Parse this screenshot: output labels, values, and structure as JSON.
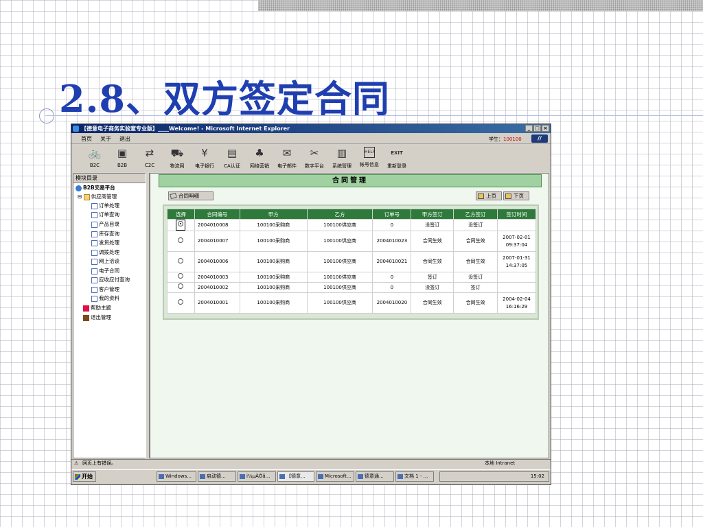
{
  "slide_title": "2.8、双方签定合同",
  "window": {
    "title": "【德意电子商务实验室专业版】____Welcome! - Microsoft Internet Explorer",
    "buttons": [
      "_",
      "□",
      "×"
    ]
  },
  "menu": {
    "items": [
      "首页",
      "关于",
      "退出"
    ],
    "student_label": "学生：",
    "student_id": "100100"
  },
  "toolbar": {
    "items": [
      {
        "label": "B2C",
        "icon": "bike-icon"
      },
      {
        "label": "B2B",
        "icon": "network-icon"
      },
      {
        "label": "C2C",
        "icon": "exchange-icon"
      },
      {
        "label": "物流网",
        "icon": "truck-icon"
      },
      {
        "label": "电子银行",
        "icon": "bank-icon"
      },
      {
        "label": "CA认证",
        "icon": "certificate-icon"
      },
      {
        "label": "网络营销",
        "icon": "org-chart-icon"
      },
      {
        "label": "电子邮件",
        "icon": "mail-icon"
      },
      {
        "label": "数字平台",
        "icon": "tools-icon"
      },
      {
        "label": "系统管理",
        "icon": "computer-icon"
      },
      {
        "label": "帐号信息",
        "icon": "help-icon"
      },
      {
        "label": "重新登录",
        "icon": "exit-icon"
      }
    ],
    "exit_caption": "EXIT",
    "help_caption": "HELP"
  },
  "sidebar": {
    "header": "模块目录",
    "root": "B2B交易平台",
    "group": "供应商管理",
    "items": [
      "订单处理",
      "订单查询",
      "产品目录",
      "库存查询",
      "发货处理",
      "调拨处理",
      "网上洽谈",
      "电子合同",
      "应收应付查询",
      "客户管理",
      "我的资料"
    ],
    "help": "帮助主题",
    "exit": "退出管理"
  },
  "main": {
    "title": "合同管理",
    "detail_button": "合同明细",
    "prev_button": "上页",
    "next_button": "下页",
    "columns": [
      "选择",
      "合同编号",
      "甲方",
      "乙方",
      "订单号",
      "甲方签订",
      "乙方签订",
      "签订时间"
    ],
    "rows": [
      {
        "checked": true,
        "id": "2004010008",
        "party_a": "100100采购商",
        "party_b": "100100供应商",
        "order": "0",
        "a_sign": "没签订",
        "b_sign": "没签订",
        "date": "",
        "time": ""
      },
      {
        "checked": false,
        "id": "2004010007",
        "party_a": "100100采购商",
        "party_b": "100100供应商",
        "order": "2004010023",
        "a_sign": "合同生效",
        "b_sign": "合同生效",
        "date": "2007-02-01",
        "time": "09:37:04"
      },
      {
        "checked": false,
        "id": "2004010006",
        "party_a": "100100采购商",
        "party_b": "100100供应商",
        "order": "2004010021",
        "a_sign": "合同生效",
        "b_sign": "合同生效",
        "date": "2007-01-31",
        "time": "14:37:05"
      },
      {
        "checked": false,
        "id": "2004010003",
        "party_a": "100100采购商",
        "party_b": "100100供应商",
        "order": "0",
        "a_sign": "签订",
        "b_sign": "没签订",
        "date": "",
        "time": ""
      },
      {
        "checked": false,
        "id": "2004010002",
        "party_a": "100100采购商",
        "party_b": "100100供应商",
        "order": "0",
        "a_sign": "没签订",
        "b_sign": "签订",
        "date": "",
        "time": ""
      },
      {
        "checked": false,
        "id": "2004010001",
        "party_a": "100100采购商",
        "party_b": "100100供应商",
        "order": "2004010020",
        "a_sign": "合同生效",
        "b_sign": "合同生效",
        "date": "2004-02-04",
        "time": "16:16:29"
      }
    ]
  },
  "status": {
    "left": "网页上有错误。",
    "zone": "本地 Intranet"
  },
  "taskbar": {
    "start": "开始",
    "tasks": [
      "Windows...",
      "启动德...",
      "i¼µÄÕã...",
      "【德意...",
      "Microsoft...",
      "德意通...",
      "文档 1 - ..."
    ],
    "clock": "15:02"
  }
}
